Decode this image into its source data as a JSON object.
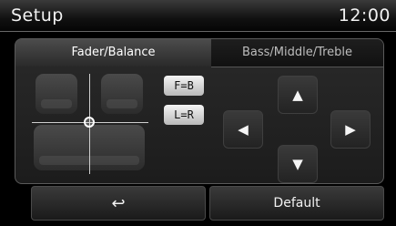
{
  "header": {
    "title": "Setup",
    "clock": "12:00"
  },
  "tabs": [
    {
      "label": "Fader/Balance",
      "active": true
    },
    {
      "label": "Bass/Middle/Treble",
      "active": false
    }
  ],
  "center_buttons": {
    "fader": "F=B",
    "balance": "L=R"
  },
  "arrows": {
    "up": "▲",
    "down": "▼",
    "left": "◀",
    "right": "▶"
  },
  "footer": {
    "back_icon": "↩",
    "default_label": "Default"
  }
}
